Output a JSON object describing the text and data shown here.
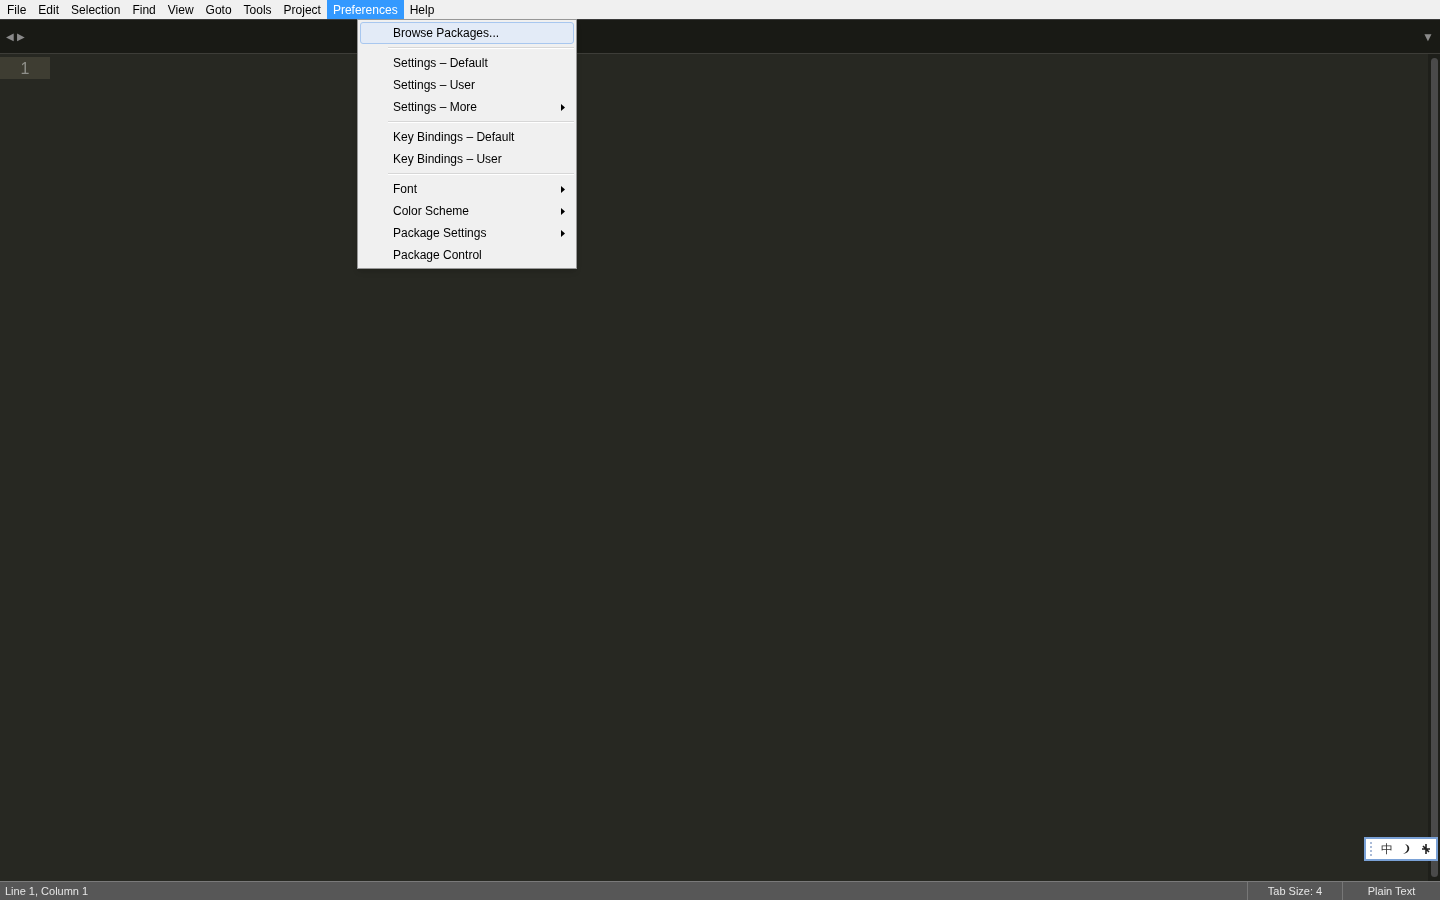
{
  "menu_bar": [
    {
      "label": "File",
      "selected": false
    },
    {
      "label": "Edit",
      "selected": false
    },
    {
      "label": "Selection",
      "selected": false
    },
    {
      "label": "Find",
      "selected": false
    },
    {
      "label": "View",
      "selected": false
    },
    {
      "label": "Goto",
      "selected": false
    },
    {
      "label": "Tools",
      "selected": false
    },
    {
      "label": "Project",
      "selected": false
    },
    {
      "label": "Preferences",
      "selected": true
    },
    {
      "label": "Help",
      "selected": false
    }
  ],
  "tab_bar": {
    "back": "◀",
    "forward": "▶",
    "overflow": "▼"
  },
  "editor": {
    "line_numbers": [
      "1"
    ]
  },
  "preferences_menu": {
    "groups": [
      {
        "items": [
          {
            "label": "Browse Packages...",
            "selected": true,
            "submenu": false
          }
        ]
      },
      {
        "items": [
          {
            "label": "Settings – Default",
            "selected": false,
            "submenu": false
          },
          {
            "label": "Settings – User",
            "selected": false,
            "submenu": false
          },
          {
            "label": "Settings – More",
            "selected": false,
            "submenu": true
          }
        ]
      },
      {
        "items": [
          {
            "label": "Key Bindings – Default",
            "selected": false,
            "submenu": false
          },
          {
            "label": "Key Bindings – User",
            "selected": false,
            "submenu": false
          }
        ]
      },
      {
        "items": [
          {
            "label": "Font",
            "selected": false,
            "submenu": true
          },
          {
            "label": "Color Scheme",
            "selected": false,
            "submenu": true
          },
          {
            "label": "Package Settings",
            "selected": false,
            "submenu": true
          },
          {
            "label": "Package Control",
            "selected": false,
            "submenu": false
          }
        ]
      }
    ]
  },
  "ime_toolbar": {
    "language": "中"
  },
  "status_bar": {
    "position": "Line 1, Column 1",
    "tab_size": "Tab Size: 4",
    "syntax": "Plain Text"
  }
}
